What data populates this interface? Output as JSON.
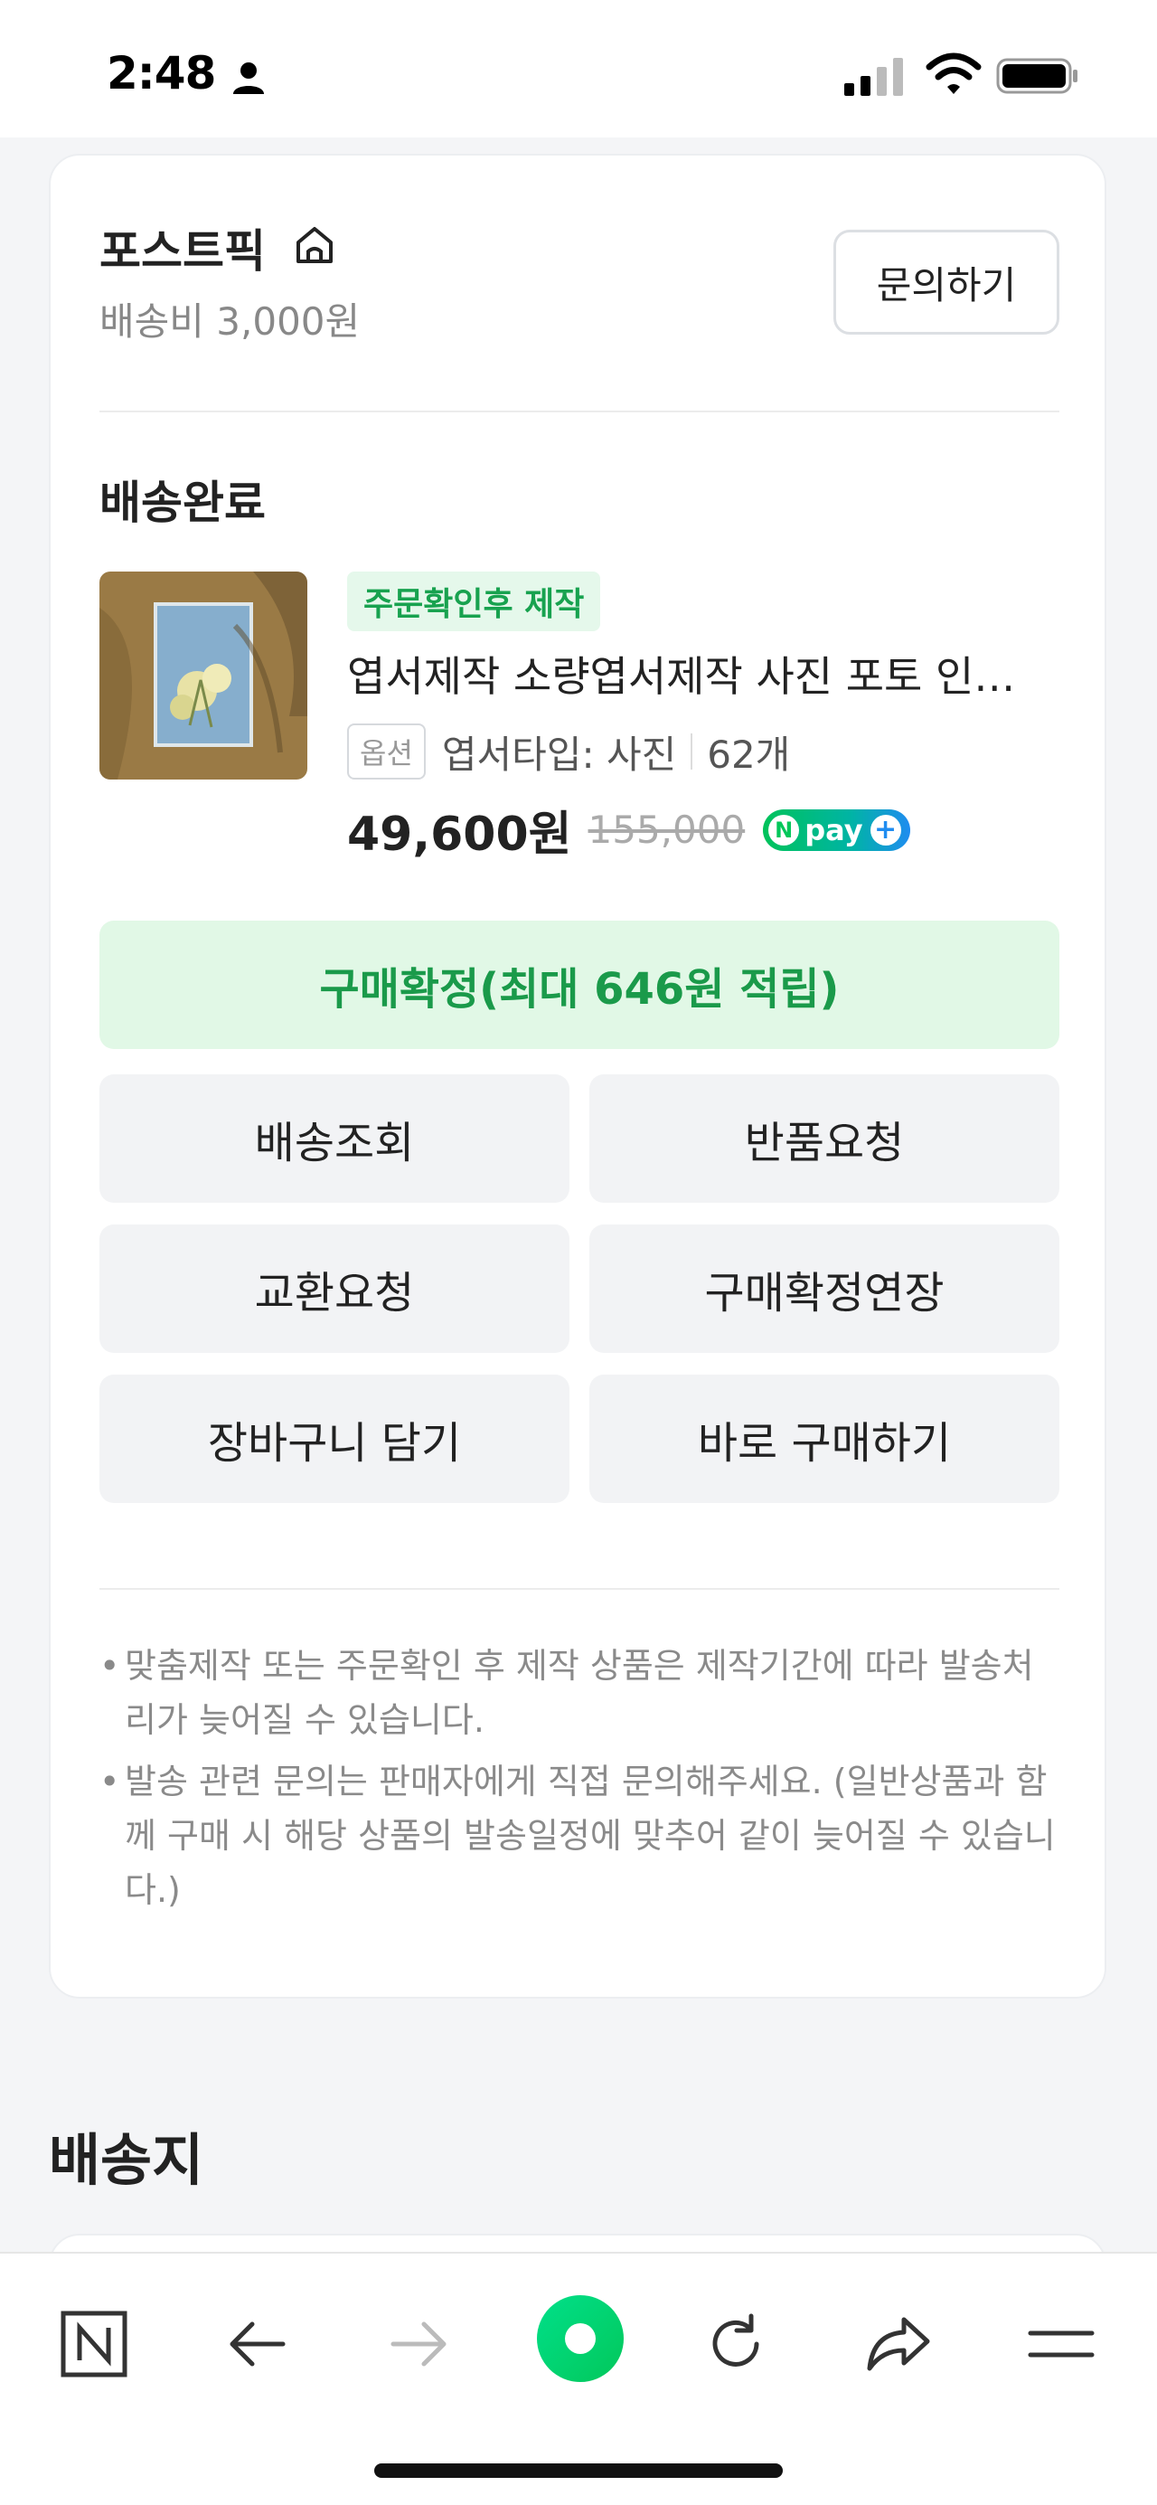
{
  "status_bar": {
    "time": "2:48"
  },
  "store": {
    "name": "포스트픽",
    "shipping_fee": "배송비 3,000원",
    "inquiry_button": "문의하기"
  },
  "order": {
    "status": "배송완료",
    "badge": "주문확인후 제작",
    "product_name": "엽서제작 소량엽서제작 사진 포토 인…",
    "option_tag": "옵션",
    "option_value": "엽서타입: 사진",
    "quantity": "62개",
    "price": "49,600원",
    "original_price": "155,000",
    "npay_label": "pay"
  },
  "actions": {
    "confirm": "구매확정(최대 646원 적립)",
    "track": "배송조회",
    "return": "반품요청",
    "exchange": "교환요청",
    "extend_confirm": "구매확정연장",
    "add_to_cart": "장바구니 담기",
    "buy_now": "바로 구매하기"
  },
  "notes": [
    "맞춤제작 또는 주문확인 후 제작 상품은 제작기간에 따라 발송처리가 늦어질 수 있습니다.",
    "발송 관련 문의는 판매자에게 직접 문의해주세요. (일반상품과 함께 구매 시 해당 상품의 발송일정에 맞추어 같이 늦어질 수 있습니다.)"
  ],
  "address_section": {
    "title": "배송지"
  },
  "colors": {
    "accent_green": "#1a9a4a",
    "badge_bg": "#e5f8eb",
    "naver_green": "#03c75a"
  }
}
